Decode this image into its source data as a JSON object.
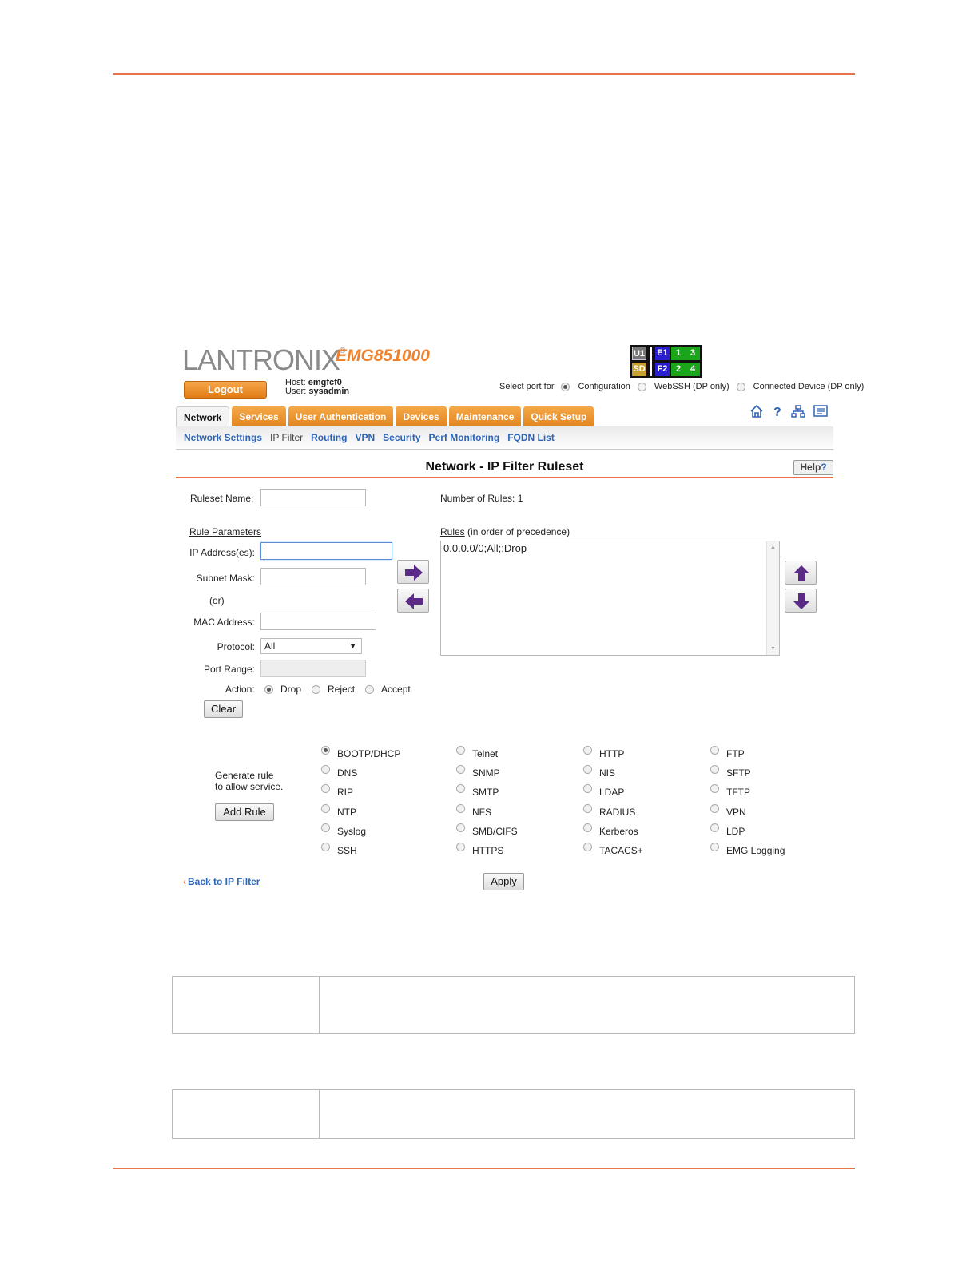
{
  "brand": {
    "logo": "LANTRONIX",
    "model": "EMG851000"
  },
  "header": {
    "logout_label": "Logout",
    "host_label": "Host:",
    "host_value": "emgfcf0",
    "user_label": "User:",
    "user_value": "sysadmin",
    "select_port_label": "Select port for",
    "port_options": [
      "Configuration",
      "WebSSH (DP only)",
      "Connected Device (DP only)"
    ],
    "port_selected": "Configuration",
    "port_grid": [
      "U1",
      "SD",
      "E1",
      "F2",
      "1",
      "2",
      "3",
      "4"
    ]
  },
  "tabs": [
    "Network",
    "Services",
    "User Authentication",
    "Devices",
    "Maintenance",
    "Quick Setup"
  ],
  "active_tab": "Network",
  "subnav": [
    "Network Settings",
    "IP Filter",
    "Routing",
    "VPN",
    "Security",
    "Perf Monitoring",
    "FQDN List"
  ],
  "active_subnav": "IP Filter",
  "page": {
    "title": "Network - IP Filter Ruleset",
    "help_label": "Help"
  },
  "form": {
    "ruleset_name_label": "Ruleset Name:",
    "ruleset_name_value": "",
    "number_of_rules_label": "Number of Rules:",
    "number_of_rules_value": "1",
    "rule_parameters_label": "Rule Parameters",
    "rules_label": "Rules",
    "rules_sub_label": "(in order of precedence)",
    "ip_label": "IP Address(es):",
    "subnet_label": "Subnet Mask:",
    "or_label": "(or)",
    "mac_label": "MAC Address:",
    "protocol_label": "Protocol:",
    "protocol_value": "All",
    "port_range_label": "Port Range:",
    "action_label": "Action:",
    "action_options": [
      "Drop",
      "Reject",
      "Accept"
    ],
    "action_selected": "Drop",
    "clear_label": "Clear",
    "rules_list": [
      "0.0.0.0/0;All;;Drop"
    ]
  },
  "services": {
    "generate_label_line1": "Generate rule",
    "generate_label_line2": "to allow service.",
    "add_rule_label": "Add Rule",
    "col1": [
      "BOOTP/DHCP",
      "DNS",
      "RIP",
      "NTP",
      "Syslog",
      "SSH"
    ],
    "col2": [
      "Telnet",
      "SNMP",
      "SMTP",
      "NFS",
      "SMB/CIFS",
      "HTTPS"
    ],
    "col3": [
      "HTTP",
      "NIS",
      "LDAP",
      "RADIUS",
      "Kerberos",
      "TACACS+"
    ],
    "col4": [
      "FTP",
      "SFTP",
      "TFTP",
      "VPN",
      "LDP",
      "EMG Logging"
    ],
    "selected": "BOOTP/DHCP"
  },
  "footer": {
    "back_label": "Back to IP Filter",
    "apply_label": "Apply"
  },
  "colors": {
    "accent": "#e8734a",
    "tab_orange": "#e28520",
    "link_blue": "#2f64b5",
    "arrow_purple": "#5b2a86"
  }
}
